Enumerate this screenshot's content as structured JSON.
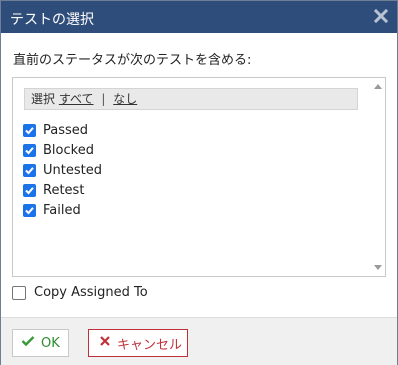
{
  "dialog": {
    "title": "テストの選択",
    "instruction": "直前のステータスが次のテストを含める:"
  },
  "selectbar": {
    "label": "選択",
    "all_label": "すべて",
    "separator": "|",
    "none_label": "なし"
  },
  "options": [
    {
      "label": "Passed",
      "checked": true
    },
    {
      "label": "Blocked",
      "checked": true
    },
    {
      "label": "Untested",
      "checked": true
    },
    {
      "label": "Retest",
      "checked": true
    },
    {
      "label": "Failed",
      "checked": true
    }
  ],
  "assigned": {
    "label": "Copy Assigned To",
    "checked": false
  },
  "buttons": {
    "ok_label": "OK",
    "cancel_label": "キャンセル"
  },
  "colors": {
    "titlebar": "#2e4d7a",
    "checkbox": "#1a73e8",
    "ok": "#2f8a2f",
    "cancel": "#c0303a"
  },
  "icons": {
    "close": "close-icon",
    "ok": "check-icon",
    "cancel": "x-icon"
  }
}
